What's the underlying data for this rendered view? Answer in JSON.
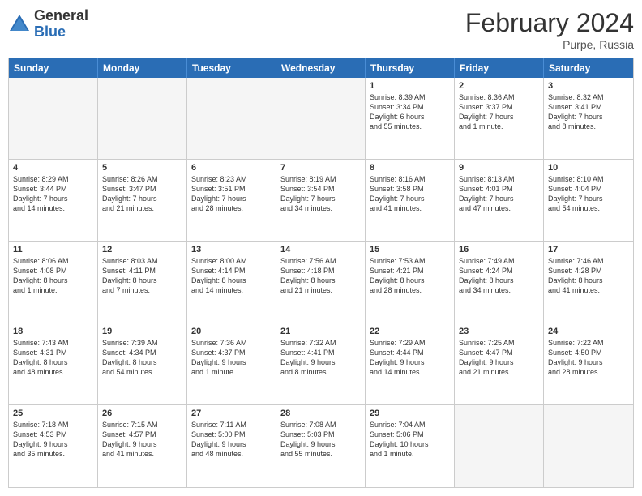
{
  "header": {
    "logo_general": "General",
    "logo_blue": "Blue",
    "month_title": "February 2024",
    "location": "Purpe, Russia"
  },
  "days": [
    "Sunday",
    "Monday",
    "Tuesday",
    "Wednesday",
    "Thursday",
    "Friday",
    "Saturday"
  ],
  "weeks": [
    [
      {
        "num": "",
        "text": "",
        "empty": true
      },
      {
        "num": "",
        "text": "",
        "empty": true
      },
      {
        "num": "",
        "text": "",
        "empty": true
      },
      {
        "num": "",
        "text": "",
        "empty": true
      },
      {
        "num": "1",
        "text": "Sunrise: 8:39 AM\nSunset: 3:34 PM\nDaylight: 6 hours\nand 55 minutes.",
        "empty": false
      },
      {
        "num": "2",
        "text": "Sunrise: 8:36 AM\nSunset: 3:37 PM\nDaylight: 7 hours\nand 1 minute.",
        "empty": false
      },
      {
        "num": "3",
        "text": "Sunrise: 8:32 AM\nSunset: 3:41 PM\nDaylight: 7 hours\nand 8 minutes.",
        "empty": false
      }
    ],
    [
      {
        "num": "4",
        "text": "Sunrise: 8:29 AM\nSunset: 3:44 PM\nDaylight: 7 hours\nand 14 minutes.",
        "empty": false
      },
      {
        "num": "5",
        "text": "Sunrise: 8:26 AM\nSunset: 3:47 PM\nDaylight: 7 hours\nand 21 minutes.",
        "empty": false
      },
      {
        "num": "6",
        "text": "Sunrise: 8:23 AM\nSunset: 3:51 PM\nDaylight: 7 hours\nand 28 minutes.",
        "empty": false
      },
      {
        "num": "7",
        "text": "Sunrise: 8:19 AM\nSunset: 3:54 PM\nDaylight: 7 hours\nand 34 minutes.",
        "empty": false
      },
      {
        "num": "8",
        "text": "Sunrise: 8:16 AM\nSunset: 3:58 PM\nDaylight: 7 hours\nand 41 minutes.",
        "empty": false
      },
      {
        "num": "9",
        "text": "Sunrise: 8:13 AM\nSunset: 4:01 PM\nDaylight: 7 hours\nand 47 minutes.",
        "empty": false
      },
      {
        "num": "10",
        "text": "Sunrise: 8:10 AM\nSunset: 4:04 PM\nDaylight: 7 hours\nand 54 minutes.",
        "empty": false
      }
    ],
    [
      {
        "num": "11",
        "text": "Sunrise: 8:06 AM\nSunset: 4:08 PM\nDaylight: 8 hours\nand 1 minute.",
        "empty": false
      },
      {
        "num": "12",
        "text": "Sunrise: 8:03 AM\nSunset: 4:11 PM\nDaylight: 8 hours\nand 7 minutes.",
        "empty": false
      },
      {
        "num": "13",
        "text": "Sunrise: 8:00 AM\nSunset: 4:14 PM\nDaylight: 8 hours\nand 14 minutes.",
        "empty": false
      },
      {
        "num": "14",
        "text": "Sunrise: 7:56 AM\nSunset: 4:18 PM\nDaylight: 8 hours\nand 21 minutes.",
        "empty": false
      },
      {
        "num": "15",
        "text": "Sunrise: 7:53 AM\nSunset: 4:21 PM\nDaylight: 8 hours\nand 28 minutes.",
        "empty": false
      },
      {
        "num": "16",
        "text": "Sunrise: 7:49 AM\nSunset: 4:24 PM\nDaylight: 8 hours\nand 34 minutes.",
        "empty": false
      },
      {
        "num": "17",
        "text": "Sunrise: 7:46 AM\nSunset: 4:28 PM\nDaylight: 8 hours\nand 41 minutes.",
        "empty": false
      }
    ],
    [
      {
        "num": "18",
        "text": "Sunrise: 7:43 AM\nSunset: 4:31 PM\nDaylight: 8 hours\nand 48 minutes.",
        "empty": false
      },
      {
        "num": "19",
        "text": "Sunrise: 7:39 AM\nSunset: 4:34 PM\nDaylight: 8 hours\nand 54 minutes.",
        "empty": false
      },
      {
        "num": "20",
        "text": "Sunrise: 7:36 AM\nSunset: 4:37 PM\nDaylight: 9 hours\nand 1 minute.",
        "empty": false
      },
      {
        "num": "21",
        "text": "Sunrise: 7:32 AM\nSunset: 4:41 PM\nDaylight: 9 hours\nand 8 minutes.",
        "empty": false
      },
      {
        "num": "22",
        "text": "Sunrise: 7:29 AM\nSunset: 4:44 PM\nDaylight: 9 hours\nand 14 minutes.",
        "empty": false
      },
      {
        "num": "23",
        "text": "Sunrise: 7:25 AM\nSunset: 4:47 PM\nDaylight: 9 hours\nand 21 minutes.",
        "empty": false
      },
      {
        "num": "24",
        "text": "Sunrise: 7:22 AM\nSunset: 4:50 PM\nDaylight: 9 hours\nand 28 minutes.",
        "empty": false
      }
    ],
    [
      {
        "num": "25",
        "text": "Sunrise: 7:18 AM\nSunset: 4:53 PM\nDaylight: 9 hours\nand 35 minutes.",
        "empty": false
      },
      {
        "num": "26",
        "text": "Sunrise: 7:15 AM\nSunset: 4:57 PM\nDaylight: 9 hours\nand 41 minutes.",
        "empty": false
      },
      {
        "num": "27",
        "text": "Sunrise: 7:11 AM\nSunset: 5:00 PM\nDaylight: 9 hours\nand 48 minutes.",
        "empty": false
      },
      {
        "num": "28",
        "text": "Sunrise: 7:08 AM\nSunset: 5:03 PM\nDaylight: 9 hours\nand 55 minutes.",
        "empty": false
      },
      {
        "num": "29",
        "text": "Sunrise: 7:04 AM\nSunset: 5:06 PM\nDaylight: 10 hours\nand 1 minute.",
        "empty": false
      },
      {
        "num": "",
        "text": "",
        "empty": true
      },
      {
        "num": "",
        "text": "",
        "empty": true
      }
    ]
  ]
}
